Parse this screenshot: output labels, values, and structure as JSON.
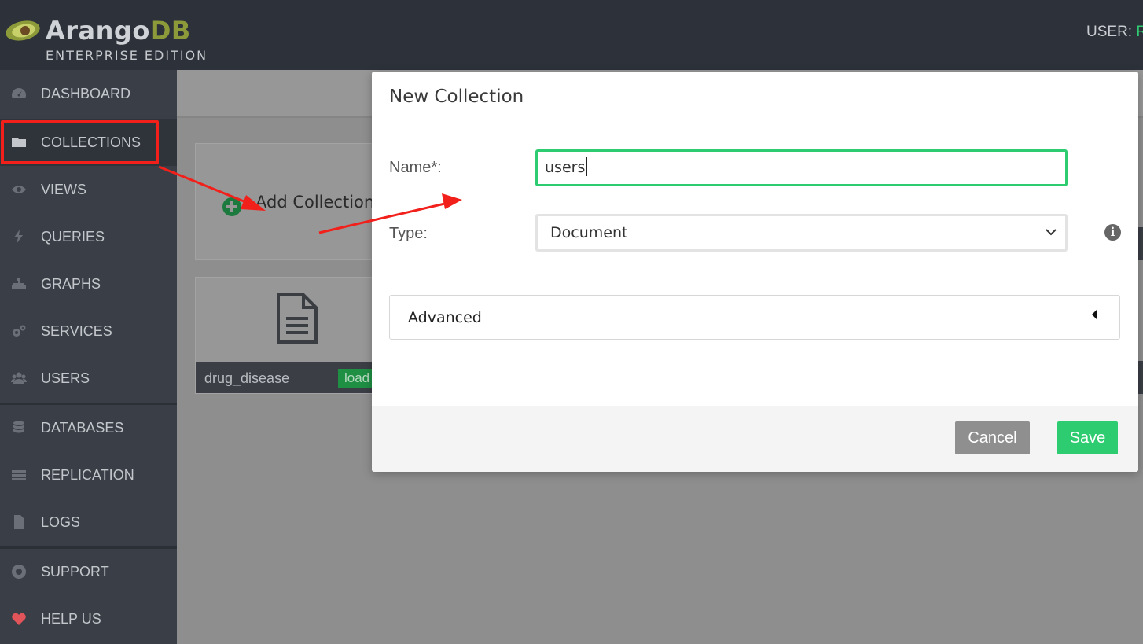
{
  "header": {
    "logo_main": "Arango",
    "logo_db": "DB",
    "logo_edition": "ENTERPRISE EDITION",
    "user_label": "USER:",
    "user_name": "R"
  },
  "sidebar": {
    "items": [
      {
        "label": "DASHBOARD",
        "icon": "dashboard-icon"
      },
      {
        "label": "COLLECTIONS",
        "icon": "folder-icon"
      },
      {
        "label": "VIEWS",
        "icon": "eye-icon"
      },
      {
        "label": "QUERIES",
        "icon": "bolt-icon"
      },
      {
        "label": "GRAPHS",
        "icon": "sitemap-icon"
      },
      {
        "label": "SERVICES",
        "icon": "cogs-icon"
      },
      {
        "label": "USERS",
        "icon": "users-icon"
      },
      {
        "label": "DATABASES",
        "icon": "database-icon"
      },
      {
        "label": "REPLICATION",
        "icon": "server-icon"
      },
      {
        "label": "LOGS",
        "icon": "file-text-icon"
      },
      {
        "label": "SUPPORT",
        "icon": "life-ring-icon"
      },
      {
        "label": "HELP US",
        "icon": "heart-icon"
      }
    ]
  },
  "content": {
    "add_collection_label": "Add Collection",
    "collection_name": "drug_disease",
    "collection_status": "load"
  },
  "modal": {
    "title": "New Collection",
    "name_label": "Name*:",
    "name_value": "users",
    "type_label": "Type:",
    "type_value": "Document",
    "info_glyph": "i",
    "advanced_label": "Advanced",
    "cancel_label": "Cancel",
    "save_label": "Save"
  },
  "colors": {
    "accent_green": "#2ecc71",
    "annotation_red": "#f2201b",
    "sidebar_bg": "#3a3f47"
  }
}
